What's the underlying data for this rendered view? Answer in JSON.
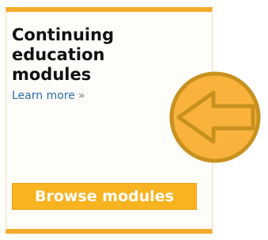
{
  "card": {
    "title": "Continuing\neducation\nmodules",
    "learn_more": "Learn more",
    "learn_more_chevron": "»",
    "browse_label": "Browse modules"
  },
  "colors": {
    "accent": "#f5aa2d",
    "button": "#f7b320",
    "link": "#2a6fb0",
    "overlay_fill": "#f9b33c",
    "overlay_stroke": "#c8911f"
  },
  "icons": {
    "overlay": "arrow-left-circle-icon"
  }
}
